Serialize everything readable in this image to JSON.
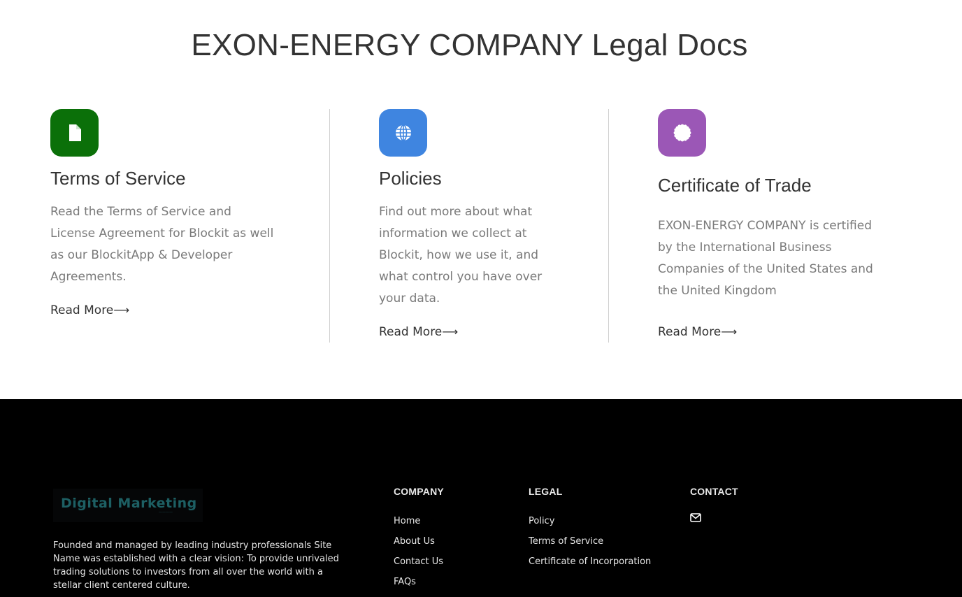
{
  "page": {
    "title": "EXON-ENERGY COMPANY Legal Docs"
  },
  "cards": [
    {
      "icon": "document-icon",
      "icon_color": "#0b7009",
      "title": "Terms of Service",
      "lines": [
        "Read the Terms of Service and",
        "License Agreement for Blockit as well",
        "as our BlockitApp & Developer",
        "Agreements."
      ],
      "link": "Read More"
    },
    {
      "icon": "globe-icon",
      "icon_color": "#3f85e0",
      "title": "Policies",
      "lines": [
        "Find out more about what",
        "information we collect at",
        "Blockit, how we use it, and",
        "what control you have over",
        "your data."
      ],
      "link": "Read More"
    },
    {
      "icon": "certificate-icon",
      "icon_color": "#9b57b6",
      "title": "Certificate of Trade",
      "lines": [
        "EXON-ENERGY COMPANY is certified",
        "by the International Business",
        "Companies of the United States and",
        "the United Kingdom"
      ],
      "link": "Read More"
    }
  ],
  "footer": {
    "logo_text": "Digital Marketing",
    "about": "Founded and managed by leading industry professionals Site Name was established with a clear vision: To provide unrivaled trading solutions to investors from all over the world with a stellar client centered culture.",
    "company": {
      "heading": "COMPANY",
      "links": [
        "Home",
        "About Us",
        "Contact Us",
        "FAQs"
      ]
    },
    "legal": {
      "heading": "LEGAL",
      "links": [
        "Policy",
        "Terms of Service",
        "Certificate of Incorporation"
      ]
    },
    "contact": {
      "heading": "CONTACT",
      "icon": "envelope-icon"
    }
  }
}
